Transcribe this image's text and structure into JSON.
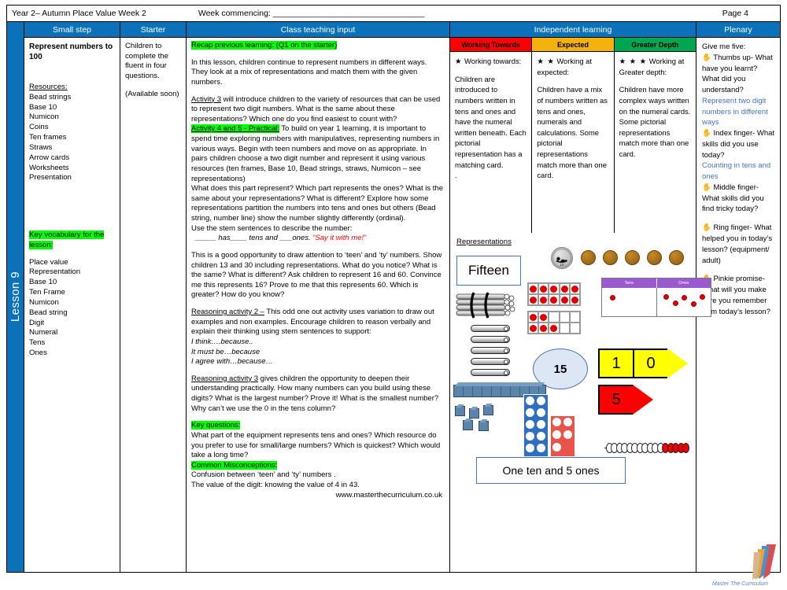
{
  "header": {
    "year_term": "Year 2– Autumn Place Value Week 2",
    "week_commencing": "Week commencing: _________________________________",
    "page": "Page 4"
  },
  "lesson_tab": "Lesson 9",
  "columns": {
    "small_step": "Small step",
    "starter": "Starter",
    "class_teaching": "Class teaching input",
    "independent": "Independent learning",
    "plenary": "Plenary"
  },
  "small_step": {
    "title": "Represent numbers to 100",
    "resources_heading": "Resources:",
    "resources": [
      "Bead strings",
      "Base 10",
      "Numicon",
      "Coins",
      "Ten frames",
      "Straws",
      "Arrow cards",
      "Worksheets",
      "Presentation"
    ],
    "vocab_heading": "Key vocabulary for the lesson:",
    "vocabulary": [
      "Place value",
      "Representation",
      "Base 10",
      "Ten Frame",
      "Numicon",
      "Bead string",
      "Digit",
      "Numeral",
      "Tens",
      "Ones"
    ]
  },
  "starter": {
    "line1": "Children to complete the fluent in four questions.",
    "line2": "(Available soon)"
  },
  "teaching": {
    "recap_heading": "Recap previous learning: (Q1 on the starter)",
    "intro": "In this lesson, children continue to represent numbers in different ways. They look at a mix of representations and match them with the given numbers.",
    "activity3_label": "Activity 3",
    "activity3_text": " will introduce children to the variety of resources that can be used to represent two digit numbers.  What is the same about these representations?   Which one do you find easiest to count with?",
    "activity45_label": "Activity 4 and 5 - Practical:",
    "activity45_text": "  To build on year 1 learning, it is important to spend time exploring numbers with manipulatives, representing numbers in various ways. Begin with teen numbers and move on as appropriate.  In pairs children choose a two digit number  and represent it using various resources (ten frames, Base 10, Bead strings, straws, Numicon – see representations)",
    "questions1": "What does this part represent?  Which part represents the ones? What is the same about your representations? What is different? Explore how some representations partition the numbers into tens and ones but others (Bead string, number line) show the number slightly  differently (ordinal).",
    "stem_intro": "Use the stem sentences to describe the number:",
    "stem_sentence": "_____ has____ tens and ___ones. ",
    "stem_say": "“Say it with me!”",
    "teen_ty": "This is a good opportunity to draw attention to ‘teen’ and ‘ty’ numbers. Show children  13 and 30 including representations.  What do you notice?  What is the same? What is different?  Ask children to represent 16 and 60.  Convince me this represents 16?  Prove to me that this represents 60. Which is greater?  How do you know?",
    "reasoning2_label": "Reasoning activity 2 –",
    "reasoning2_text": " This odd one out activity uses variation to draw out examples and non examples.  Encourage children to reason verbally and explain their thinking using stem sentences to support:",
    "stems": [
      "I think….because..",
      "It must be…because",
      "I agree with…because…"
    ],
    "reasoning3_label": "Reasoning activity 3",
    "reasoning3_text": " gives children the opportunity to deepen their understanding practically. How many numbers can you build using these digits? What is the largest number? Prove it!  What is the smallest number?   Why can’t we use the 0 in the tens column?",
    "key_questions_heading": "Key questions:",
    "key_questions": "What part of the equipment represents tens and ones? Which resource do you prefer to use for small/large numbers? Which is quickest? Which would take a long time?",
    "misconceptions_heading": "Common Misconceptions:",
    "misconceptions": [
      "Confusion between ‘teen’ and ‘ty’  numbers .",
      "The value of the digit: knowing the value of 4 in 43."
    ],
    "website": "www.masterthecurriculum.co.uk"
  },
  "independent": {
    "bands": [
      {
        "label": "Working Towards",
        "color": "#ff0000",
        "stars": "★",
        "heading": "Working towards:",
        "text": "Children are introduced to numbers written in tens and ones and have the numeral written beneath. Each pictorial representation has a matching card.",
        "trailing": "."
      },
      {
        "label": "Expected",
        "color": "#f5b10d",
        "stars": "★ ★",
        "heading": "Working at expected:",
        "text": "Children have a mix of numbers written as tens and ones, numerals and calculations. Some pictorial representations match more than one card.",
        "trailing": ""
      },
      {
        "label": "Greater Depth",
        "color": "#00a650",
        "stars": "★ ★ ★",
        "heading": "Working at Greater depth:",
        "text": "Children have more complex ways written on the numeral cards. Some pictorial representations match more than one card.",
        "trailing": ""
      }
    ],
    "representations_label": "Representations"
  },
  "representations": {
    "word_card": "Fifteen",
    "numeral_oval": "15",
    "sentence_card": "One ten and 5 ones",
    "arrow_card_tens": "1",
    "arrow_card_tens_zero": "0",
    "arrow_card_ones": "5",
    "arrow_tens_color": "#ffff00",
    "arrow_ones_color": "#ff0000",
    "place_value_chart": {
      "tens_label": "Tens",
      "ones_label": "Ones",
      "tens_count": 1,
      "ones_count": 5
    },
    "ten_frames": {
      "full_count": 10,
      "partial_count": 5
    },
    "coins": {
      "ten_pence": "10",
      "ten_pence_legend": "TEN PENCE",
      "penny_count": 5
    },
    "bead_string": {
      "white": 11,
      "red": 5
    },
    "numicon": {
      "blue_holes": 10,
      "red_holes": 5
    },
    "base10": {
      "rod_segments": 10,
      "cubes": 5
    },
    "straws": {
      "bundle": 1,
      "singles": 5
    }
  },
  "plenary": {
    "heading": "Give me five:",
    "items": [
      {
        "icon": "✋",
        "label": " Thumbs up- What have you learnt? What did you understand?",
        "answer": "Represent two digit numbers in different ways"
      },
      {
        "icon": "✋",
        "label": " Index finger- What skills did you use today?",
        "answer": "Counting in tens and ones"
      },
      {
        "icon": "✋",
        "label": " Middle finger- What skills did you find tricky today?",
        "answer": ""
      },
      {
        "icon": "✋",
        "label": " Ring finger- What helped you in today’s lesson? (equipment/ adult)",
        "answer": ""
      },
      {
        "icon": "✋",
        "label": " Pinkie promise- What will you make sure you remember from today’s lesson?",
        "answer": ""
      }
    ]
  },
  "logo": {
    "script": "Master The Curriculum"
  }
}
